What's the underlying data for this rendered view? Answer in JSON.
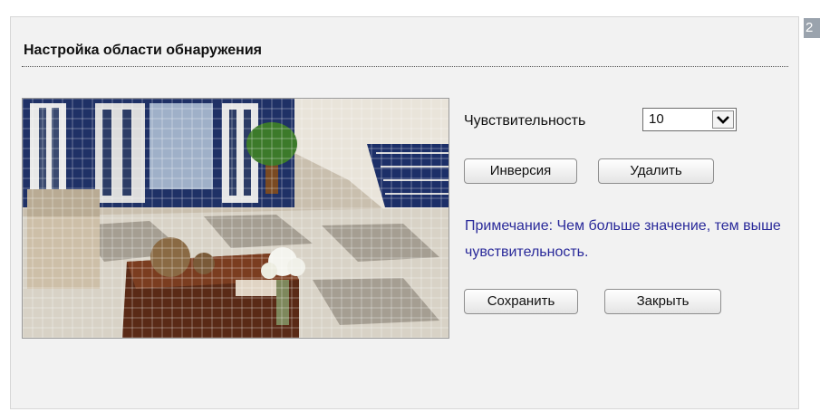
{
  "page_badge": "2",
  "dialog": {
    "title": "Настройка области обнаружения"
  },
  "preview": {
    "description_icon": "camera-preview-grid"
  },
  "sensitivity": {
    "label": "Чувствительность",
    "value": "10"
  },
  "buttons": {
    "invert_label": "Инверсия",
    "delete_label": "Удалить",
    "save_label": "Сохранить",
    "close_label": "Закрыть"
  },
  "note": {
    "text": "Примечание: Чем больше значение, тем выше чувствительность."
  },
  "colors": {
    "panel_bg": "#f2f2f2",
    "note_text": "#2a2a9a",
    "badge_bg": "#9aa3ad"
  }
}
